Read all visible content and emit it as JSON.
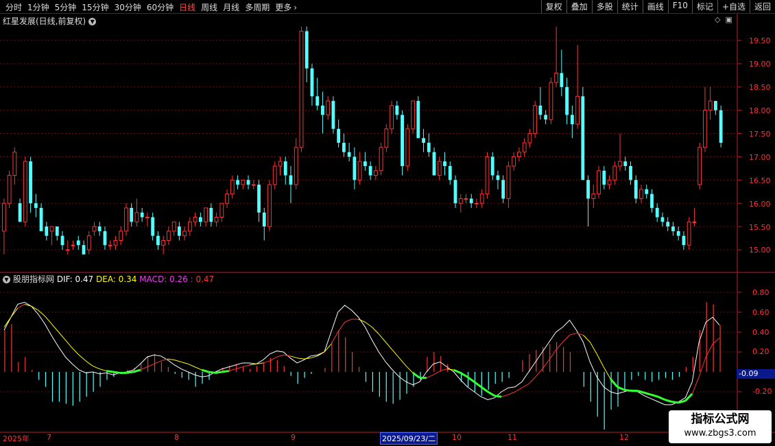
{
  "toolbar": {
    "periods": [
      "分时",
      "1分钟",
      "5分钟",
      "15分钟",
      "30分钟",
      "60分钟",
      "日线",
      "周线",
      "月线",
      "多周期",
      "更多"
    ],
    "active_period": "日线",
    "actions": [
      "复权",
      "叠加",
      "多股",
      "统计",
      "画线",
      "F10",
      "标记",
      "+自选",
      "返回"
    ]
  },
  "stock_title": "红星发展(日线,前复权)",
  "price_axis_ticks": [
    "19.50",
    "19.00",
    "18.50",
    "18.00",
    "17.50",
    "17.00",
    "16.50",
    "16.00",
    "15.50",
    "15.00"
  ],
  "indicator": {
    "name": "股朋指标网",
    "dif_label": "DIF: 0.47",
    "dea_label": "DEA: 0.34",
    "macd_label": "MACD: 0.26",
    "macd_extra": ": 0.47",
    "axis_ticks": [
      "0.80",
      "0.60",
      "0.40",
      "0.20",
      "-0.20"
    ],
    "readout": "-0.09"
  },
  "date_axis": {
    "labels": [
      "2025年",
      "7",
      "8",
      "9",
      "10",
      "11",
      "12"
    ],
    "selected_date": "2025/09/23/二"
  },
  "watermark": {
    "title": "指标公式网",
    "url": "www.zbgs3.com"
  },
  "colors": {
    "up": "#ff3333",
    "down": "#54ffff",
    "dif": "#ffffff",
    "dea": "#ffff00",
    "macd_green": "#33ff33"
  },
  "chart_data": {
    "type": "candlestick",
    "price_ylim": [
      14.8,
      19.8
    ],
    "macd_ylim": [
      -0.58,
      0.98
    ],
    "candles": [
      [
        15.4,
        16.1,
        14.9,
        16.0
      ],
      [
        16.0,
        16.7,
        15.9,
        16.6
      ],
      [
        16.6,
        17.2,
        16.4,
        17.1
      ],
      [
        16.0,
        16.1,
        15.6,
        15.6
      ],
      [
        15.6,
        17.0,
        15.5,
        16.9
      ],
      [
        16.9,
        17.0,
        15.8,
        16.0
      ],
      [
        16.0,
        16.2,
        15.7,
        15.9
      ],
      [
        15.9,
        16.0,
        15.4,
        15.4
      ],
      [
        15.5,
        15.6,
        15.2,
        15.3
      ],
      [
        15.4,
        15.5,
        15.1,
        15.5
      ],
      [
        15.5,
        15.5,
        15.2,
        15.3
      ],
      [
        15.3,
        15.4,
        15.0,
        15.1
      ],
      [
        15.0,
        15.2,
        14.9,
        15.0
      ],
      [
        15.1,
        15.2,
        15.0,
        15.1
      ],
      [
        15.2,
        15.3,
        15.0,
        15.1
      ],
      [
        15.1,
        15.2,
        14.9,
        14.9
      ],
      [
        15.0,
        15.4,
        14.9,
        15.3
      ],
      [
        15.4,
        15.6,
        15.3,
        15.5
      ],
      [
        15.5,
        15.6,
        15.3,
        15.4
      ],
      [
        15.4,
        15.5,
        15.0,
        15.1
      ],
      [
        15.1,
        15.2,
        15.0,
        15.1
      ],
      [
        15.1,
        15.3,
        15.0,
        15.2
      ],
      [
        15.2,
        15.5,
        15.1,
        15.4
      ],
      [
        15.4,
        16.0,
        15.3,
        15.9
      ],
      [
        15.9,
        16.0,
        15.5,
        15.6
      ],
      [
        15.6,
        16.1,
        15.5,
        15.8
      ],
      [
        15.8,
        15.9,
        15.6,
        15.7
      ],
      [
        15.7,
        15.8,
        15.5,
        15.7
      ],
      [
        15.7,
        15.8,
        15.2,
        15.3
      ],
      [
        15.3,
        15.4,
        15.0,
        15.1
      ],
      [
        15.1,
        15.3,
        14.9,
        15.2
      ],
      [
        15.2,
        15.5,
        15.1,
        15.4
      ],
      [
        15.4,
        15.6,
        15.3,
        15.6
      ],
      [
        15.5,
        15.6,
        15.2,
        15.3
      ],
      [
        15.3,
        15.5,
        15.2,
        15.4
      ],
      [
        15.4,
        15.7,
        15.3,
        15.6
      ],
      [
        15.6,
        15.8,
        15.5,
        15.7
      ],
      [
        15.7,
        15.8,
        15.5,
        15.6
      ],
      [
        15.6,
        15.9,
        15.5,
        15.9
      ],
      [
        15.9,
        16.0,
        15.5,
        15.6
      ],
      [
        15.6,
        15.8,
        15.5,
        15.7
      ],
      [
        15.7,
        16.0,
        15.6,
        16.0
      ],
      [
        16.0,
        16.3,
        15.9,
        16.2
      ],
      [
        16.2,
        16.6,
        16.1,
        16.5
      ],
      [
        16.5,
        16.6,
        16.3,
        16.4
      ],
      [
        16.4,
        16.5,
        16.3,
        16.5
      ],
      [
        16.5,
        16.6,
        16.3,
        16.4
      ],
      [
        16.4,
        16.5,
        16.3,
        16.4
      ],
      [
        16.4,
        16.5,
        15.6,
        15.8
      ],
      [
        15.8,
        15.9,
        15.2,
        15.5
      ],
      [
        15.5,
        16.5,
        15.4,
        16.4
      ],
      [
        16.4,
        16.9,
        16.3,
        16.8
      ],
      [
        16.8,
        17.0,
        16.6,
        16.9
      ],
      [
        16.9,
        17.0,
        16.4,
        16.6
      ],
      [
        16.6,
        16.8,
        16.0,
        16.4
      ],
      [
        16.4,
        17.4,
        16.3,
        17.2
      ],
      [
        17.2,
        19.8,
        17.1,
        19.7
      ],
      [
        19.7,
        19.8,
        18.6,
        18.9
      ],
      [
        18.9,
        19.0,
        18.1,
        18.3
      ],
      [
        18.3,
        18.7,
        18.0,
        18.1
      ],
      [
        18.1,
        18.4,
        17.5,
        17.9
      ],
      [
        17.9,
        18.3,
        17.8,
        18.2
      ],
      [
        18.2,
        18.3,
        17.5,
        17.6
      ],
      [
        17.6,
        17.8,
        17.2,
        17.3
      ],
      [
        17.3,
        17.5,
        17.0,
        17.1
      ],
      [
        17.1,
        17.3,
        16.9,
        17.0
      ],
      [
        17.0,
        17.2,
        16.3,
        16.5
      ],
      [
        16.5,
        17.1,
        16.4,
        16.9
      ],
      [
        16.9,
        17.1,
        16.7,
        16.8
      ],
      [
        16.8,
        16.9,
        16.5,
        16.6
      ],
      [
        16.6,
        16.8,
        16.5,
        16.7
      ],
      [
        16.7,
        17.3,
        16.6,
        17.2
      ],
      [
        17.2,
        17.7,
        17.1,
        17.6
      ],
      [
        17.6,
        18.2,
        17.5,
        18.1
      ],
      [
        18.1,
        18.2,
        17.8,
        17.9
      ],
      [
        17.9,
        18.0,
        16.6,
        16.8
      ],
      [
        16.8,
        17.7,
        16.7,
        17.6
      ],
      [
        17.6,
        18.2,
        17.5,
        18.2
      ],
      [
        18.2,
        18.3,
        17.4,
        17.4
      ],
      [
        17.4,
        17.6,
        17.1,
        17.3
      ],
      [
        17.3,
        17.5,
        17.0,
        17.1
      ],
      [
        17.1,
        17.2,
        16.6,
        16.6
      ],
      [
        16.6,
        17.0,
        16.5,
        16.9
      ],
      [
        16.9,
        17.1,
        16.6,
        16.8
      ],
      [
        16.8,
        16.9,
        16.4,
        16.5
      ],
      [
        16.5,
        16.6,
        15.9,
        16.0
      ],
      [
        16.0,
        16.2,
        15.8,
        16.1
      ],
      [
        16.1,
        16.2,
        16.0,
        16.1
      ],
      [
        16.1,
        16.2,
        15.9,
        16.0
      ],
      [
        16.0,
        16.1,
        15.9,
        16.0
      ],
      [
        16.0,
        16.3,
        15.9,
        16.2
      ],
      [
        16.2,
        17.1,
        16.1,
        17.0
      ],
      [
        17.0,
        17.1,
        16.5,
        16.6
      ],
      [
        16.6,
        16.7,
        16.3,
        16.5
      ],
      [
        16.5,
        16.6,
        16.0,
        16.1
      ],
      [
        16.1,
        16.9,
        15.9,
        16.8
      ],
      [
        16.8,
        17.1,
        16.7,
        17.0
      ],
      [
        17.0,
        17.2,
        16.9,
        17.1
      ],
      [
        17.1,
        17.4,
        17.0,
        17.3
      ],
      [
        17.3,
        17.6,
        17.2,
        17.5
      ],
      [
        17.5,
        18.2,
        17.4,
        18.1
      ],
      [
        18.1,
        18.5,
        17.8,
        17.9
      ],
      [
        17.9,
        18.0,
        17.7,
        17.8
      ],
      [
        17.8,
        18.7,
        17.7,
        18.6
      ],
      [
        18.6,
        19.8,
        18.5,
        18.8
      ],
      [
        18.8,
        19.3,
        18.3,
        18.5
      ],
      [
        18.5,
        18.7,
        17.7,
        17.9
      ],
      [
        17.9,
        18.1,
        17.4,
        17.7
      ],
      [
        17.7,
        19.4,
        17.6,
        18.3
      ],
      [
        18.3,
        18.5,
        16.7,
        16.5
      ],
      [
        16.5,
        16.6,
        15.5,
        16.1
      ],
      [
        16.1,
        16.4,
        15.9,
        16.2
      ],
      [
        16.2,
        16.8,
        16.1,
        16.7
      ],
      [
        16.7,
        16.8,
        16.3,
        16.4
      ],
      [
        16.4,
        16.6,
        16.3,
        16.5
      ],
      [
        16.5,
        16.9,
        16.4,
        16.8
      ],
      [
        16.8,
        17.5,
        16.7,
        16.9
      ],
      [
        16.9,
        17.0,
        16.7,
        16.8
      ],
      [
        16.8,
        16.9,
        16.4,
        16.5
      ],
      [
        16.5,
        16.6,
        16.0,
        16.1
      ],
      [
        16.1,
        16.4,
        16.0,
        16.3
      ],
      [
        16.3,
        16.4,
        16.1,
        16.2
      ],
      [
        16.2,
        16.3,
        15.8,
        15.9
      ],
      [
        15.9,
        16.0,
        15.6,
        15.7
      ],
      [
        15.7,
        15.8,
        15.5,
        15.6
      ],
      [
        15.6,
        15.7,
        15.4,
        15.5
      ],
      [
        15.5,
        15.6,
        15.3,
        15.4
      ],
      [
        15.4,
        15.5,
        15.2,
        15.3
      ],
      [
        15.3,
        15.4,
        15.0,
        15.1
      ],
      [
        15.1,
        15.7,
        15.0,
        15.6
      ],
      [
        15.6,
        15.9,
        15.5,
        15.6
      ],
      [
        16.4,
        17.3,
        16.3,
        17.2
      ],
      [
        17.2,
        18.5,
        17.1,
        18.0
      ],
      [
        18.0,
        18.5,
        17.8,
        18.2
      ],
      [
        18.2,
        18.2,
        17.9,
        18.0
      ],
      [
        18.0,
        18.1,
        17.2,
        17.3
      ]
    ],
    "dif": [
      0.42,
      0.55,
      0.68,
      0.7,
      0.66,
      0.58,
      0.48,
      0.36,
      0.25,
      0.15,
      0.08,
      0.02,
      -0.01,
      0.0,
      -0.02,
      -0.01,
      -0.03,
      -0.01,
      0.0,
      0.02,
      0.08,
      0.15,
      0.17,
      0.16,
      0.12,
      0.07,
      0.03,
      0.0,
      -0.03,
      -0.05,
      -0.04,
      0.0,
      0.03,
      0.05,
      0.07,
      0.09,
      0.09,
      0.08,
      0.12,
      0.18,
      0.21,
      0.2,
      0.14,
      0.09,
      0.12,
      0.16,
      0.17,
      0.2,
      0.4,
      0.6,
      0.67,
      0.62,
      0.55,
      0.45,
      0.32,
      0.2,
      0.1,
      0.02,
      -0.05,
      -0.1,
      -0.13,
      -0.1,
      0.0,
      0.08,
      0.1,
      0.05,
      0.0,
      -0.08,
      -0.15,
      -0.2,
      -0.25,
      -0.28,
      -0.26,
      -0.2,
      -0.16,
      -0.15,
      -0.1,
      0.0,
      0.1,
      0.2,
      0.3,
      0.4,
      0.45,
      0.52,
      0.42,
      0.3,
      0.1,
      -0.05,
      -0.15,
      -0.2,
      -0.22,
      -0.2,
      -0.18,
      -0.2,
      -0.24,
      -0.27,
      -0.3,
      -0.33,
      -0.33,
      -0.3,
      -0.26,
      -0.1,
      0.3,
      0.5,
      0.55,
      0.47
    ],
    "dea": [
      0.45,
      0.55,
      0.64,
      0.68,
      0.66,
      0.62,
      0.56,
      0.48,
      0.4,
      0.32,
      0.24,
      0.17,
      0.11,
      0.06,
      0.03,
      0.01,
      0.0,
      -0.01,
      -0.01,
      0.0,
      0.02,
      0.05,
      0.08,
      0.11,
      0.13,
      0.12,
      0.1,
      0.08,
      0.05,
      0.02,
      0.0,
      -0.01,
      0.0,
      0.01,
      0.03,
      0.05,
      0.07,
      0.08,
      0.09,
      0.11,
      0.15,
      0.17,
      0.16,
      0.14,
      0.13,
      0.14,
      0.16,
      0.2,
      0.28,
      0.4,
      0.5,
      0.53,
      0.53,
      0.5,
      0.45,
      0.38,
      0.3,
      0.22,
      0.14,
      0.06,
      -0.01,
      -0.06,
      -0.06,
      -0.03,
      0.01,
      0.03,
      0.02,
      -0.01,
      -0.05,
      -0.1,
      -0.15,
      -0.2,
      -0.24,
      -0.25,
      -0.23,
      -0.2,
      -0.16,
      -0.12,
      -0.05,
      0.03,
      0.12,
      0.22,
      0.3,
      0.37,
      0.39,
      0.37,
      0.3,
      0.18,
      0.05,
      -0.07,
      -0.15,
      -0.18,
      -0.19,
      -0.19,
      -0.21,
      -0.23,
      -0.25,
      -0.28,
      -0.3,
      -0.31,
      -0.29,
      -0.22,
      -0.05,
      0.15,
      0.28,
      0.34
    ],
    "macd": [
      0.42,
      0.48,
      0.1,
      0.15,
      0.02,
      -0.08,
      -0.15,
      -0.3,
      -0.3,
      -0.32,
      -0.34,
      -0.3,
      -0.25,
      -0.2,
      -0.15,
      -0.08,
      -0.05,
      -0.02,
      0.02,
      0.04,
      0.08,
      0.16,
      0.18,
      0.1,
      0.05,
      -0.02,
      -0.06,
      -0.08,
      -0.15,
      -0.12,
      -0.08,
      -0.02,
      0.04,
      0.06,
      0.08,
      0.05,
      0.03,
      0.06,
      0.1,
      0.14,
      0.12,
      0.06,
      -0.04,
      -0.12,
      -0.06,
      -0.02,
      0.0,
      0.04,
      0.3,
      0.42,
      0.35,
      0.2,
      0.05,
      -0.1,
      -0.2,
      -0.25,
      -0.3,
      -0.32,
      -0.28,
      -0.22,
      -0.15,
      -0.08,
      0.15,
      0.2,
      0.16,
      0.08,
      0.0,
      -0.1,
      -0.15,
      -0.2,
      -0.24,
      -0.18,
      -0.12,
      -0.1,
      -0.06,
      0.0,
      0.12,
      0.18,
      0.22,
      0.25,
      0.28,
      0.3,
      0.25,
      0.2,
      0.0,
      -0.15,
      -0.3,
      -0.45,
      -0.58,
      -0.38,
      -0.35,
      -0.2,
      -0.08,
      -0.04,
      -0.08,
      -0.1,
      -0.08,
      -0.06,
      -0.08,
      -0.05,
      0.05,
      0.15,
      0.42,
      0.7,
      0.68,
      0.47
    ]
  }
}
